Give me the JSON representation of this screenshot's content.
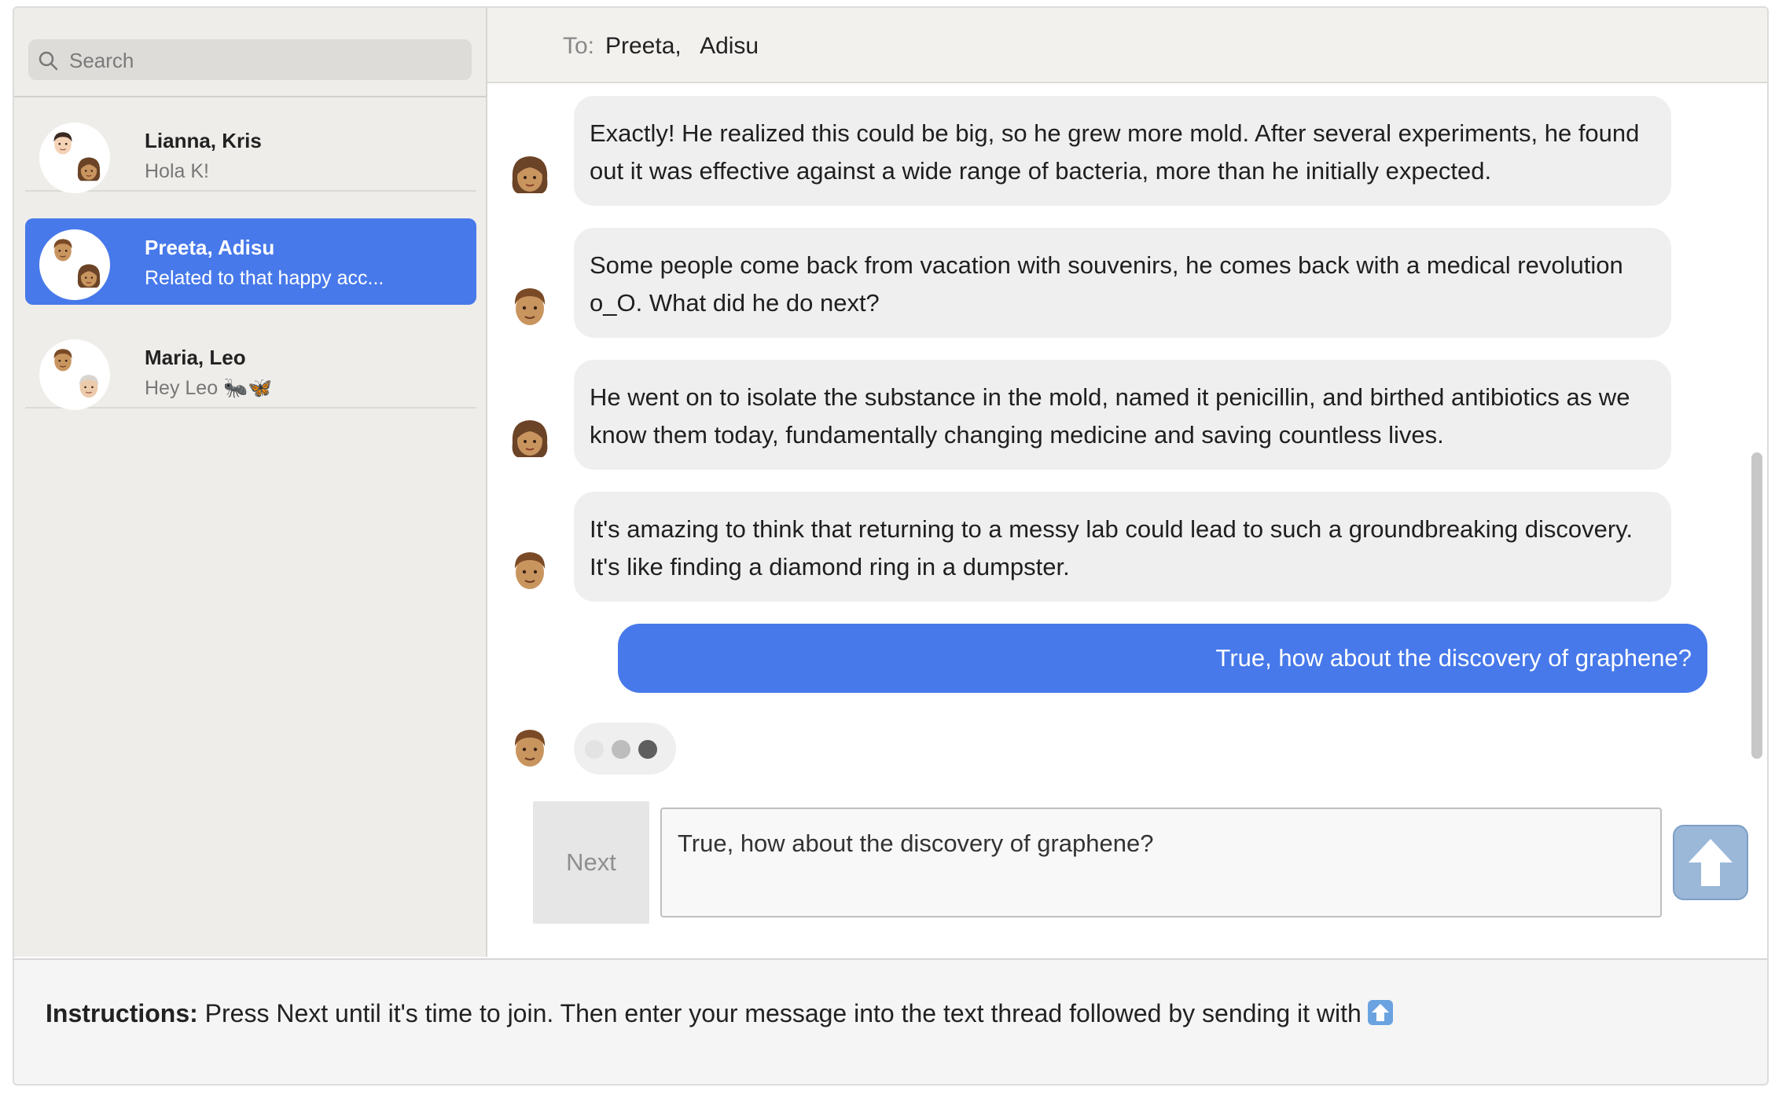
{
  "search": {
    "placeholder": "Search"
  },
  "conversations": [
    {
      "name": "Lianna, Kris",
      "preview": "Hola K!"
    },
    {
      "name": "Preeta, Adisu",
      "preview": "Related to that happy acc..."
    },
    {
      "name": "Maria, Leo",
      "preview": "Hey Leo 🐜🦋"
    }
  ],
  "header": {
    "to_label": "To:",
    "recipients": "Preeta,   Adisu"
  },
  "messages": [
    {
      "sender": "Preeta",
      "text": "Exactly! He realized this could be big, so he grew more mold. After several experiments, he found out it was effective against a wide range of bacteria, more than he initially expected."
    },
    {
      "sender": "Adisu",
      "text": "Some people come back from vacation with souvenirs, he comes back with a medical revolution o_O. What did he do next?"
    },
    {
      "sender": "Preeta",
      "text": "He went on to isolate the substance in the mold, named it penicillin, and birthed antibiotics as we know them today, fundamentally changing medicine and saving countless lives."
    },
    {
      "sender": "Adisu",
      "text": "It's amazing to think that returning to a messy lab could lead to such a groundbreaking discovery. It's like finding a diamond ring in a dumpster."
    },
    {
      "sender": "me",
      "text": "True, how about the discovery of graphene?"
    }
  ],
  "composer": {
    "next_label": "Next",
    "input_value": "True, how about the discovery of graphene?"
  },
  "instructions": {
    "label": "Instructions:",
    "text": " Press Next until it's time to join. Then enter your message into the text thread followed by sending it with"
  },
  "colors": {
    "accent": "#4779ea",
    "sidebar_bg": "#efedea",
    "bubble_bg": "#efefef",
    "send_button": "#9bb8d9"
  },
  "icons": {
    "search": "magnifier-icon",
    "send": "up-arrow-icon",
    "avatar_woman": "woman-emoji-icon",
    "avatar_man": "man-emoji-icon"
  }
}
